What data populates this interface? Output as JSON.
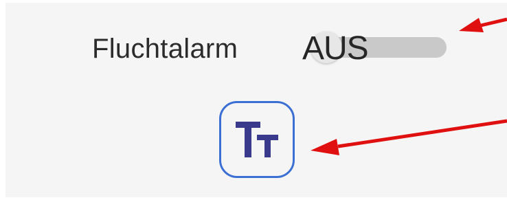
{
  "setting": {
    "label": "Fluchtalarm",
    "toggle_state": "AUS",
    "toggle_on": false
  },
  "font_button": {
    "icon": "text-size-icon",
    "border_color": "#3b6fd4",
    "glyph_color": "#3a3a8c"
  },
  "annotations": {
    "arrow_color": "#e01010",
    "arrows": [
      "toggle-arrow",
      "font-size-arrow"
    ]
  }
}
